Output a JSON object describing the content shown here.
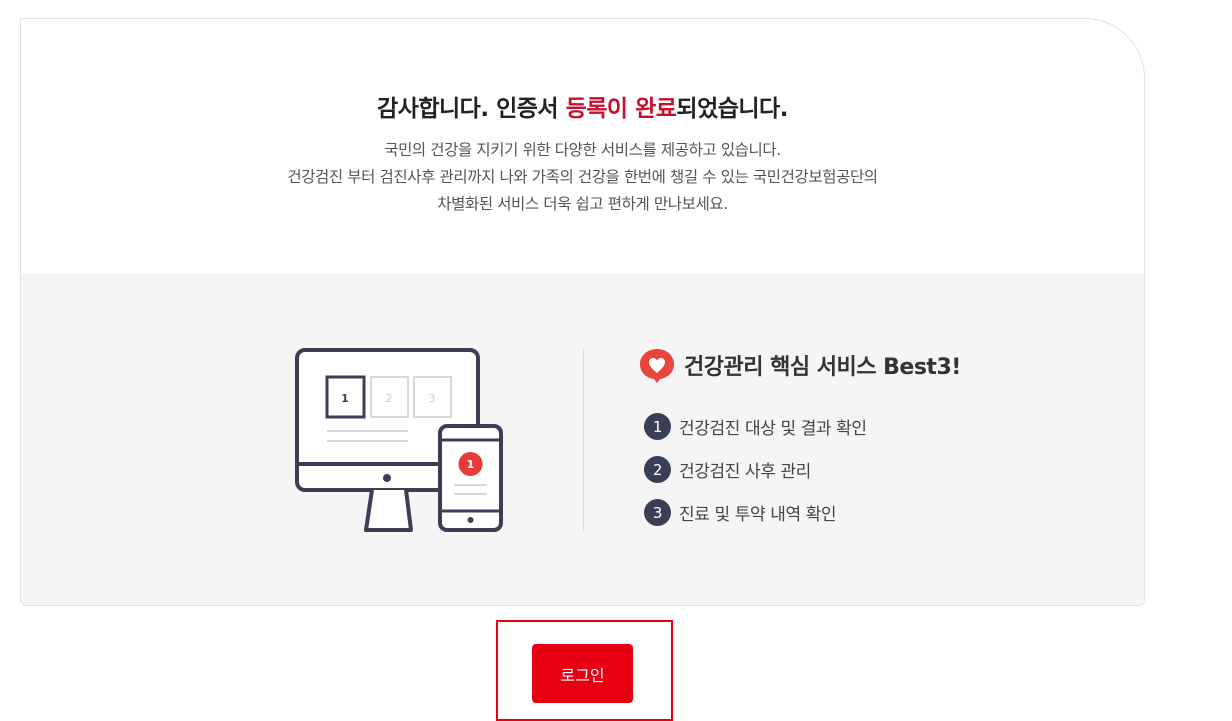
{
  "headline": {
    "before": "감사합니다. 인증서 ",
    "accent": "등록이 완료",
    "after": "되었습니다."
  },
  "description": {
    "line1": "국민의 건강을 지키기 위한 다양한 서비스를 제공하고 있습니다.",
    "line2": "건강검진 부터 검진사후 관리까지 나와 가족의 건강을 한번에 챙길 수 있는 국민건강보험공단의",
    "line3": "차별화된 서비스 더욱 쉽고 편하게 만나보세요."
  },
  "illustration": {
    "monitor_tabs": [
      "1",
      "2",
      "3"
    ],
    "phone_badge": "1"
  },
  "best": {
    "icon": "heart-bubble-icon",
    "title": "건강관리 핵심 서비스 Best3!",
    "items": [
      {
        "num": "1",
        "label": "건강검진 대상 및 결과 확인"
      },
      {
        "num": "2",
        "label": "건강검진 사후 관리"
      },
      {
        "num": "3",
        "label": "진료 및 투약 내역 확인"
      }
    ]
  },
  "login": {
    "label": "로그인"
  },
  "colors": {
    "accent": "#c8102e",
    "button": "#e60012",
    "badge": "#3b3f55"
  }
}
